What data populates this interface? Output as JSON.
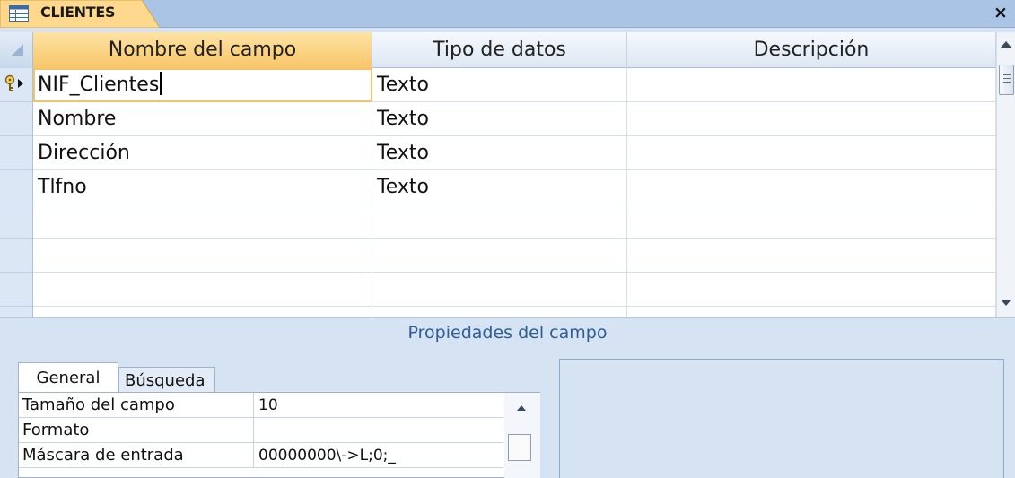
{
  "window": {
    "title": "CLIENTES",
    "table_icon": "table-icon",
    "close_icon": "close-icon",
    "close_glyph": "×"
  },
  "grid": {
    "columns": [
      "Nombre del campo",
      "Tipo de datos",
      "Descripción"
    ],
    "rows": [
      {
        "field": "NIF_Clientes",
        "type": "Texto",
        "description": "",
        "primary_key": true,
        "current": true
      },
      {
        "field": "Nombre",
        "type": "Texto",
        "description": ""
      },
      {
        "field": "Dirección",
        "type": "Texto",
        "description": ""
      },
      {
        "field": "Tlfno",
        "type": "Texto",
        "description": ""
      },
      {
        "field": "",
        "type": "",
        "description": ""
      },
      {
        "field": "",
        "type": "",
        "description": ""
      },
      {
        "field": "",
        "type": "",
        "description": ""
      }
    ]
  },
  "properties": {
    "header": "Propiedades del campo",
    "tabs": [
      "General",
      "Búsqueda"
    ],
    "active_tab": "General",
    "rows": [
      {
        "name": "Tamaño del campo",
        "value": "10"
      },
      {
        "name": "Formato",
        "value": ""
      },
      {
        "name": "Máscara de entrada",
        "value": "00000000\\->L;0;_"
      }
    ]
  },
  "colors": {
    "active_header": "#f8c66a",
    "titlebar": "#a9c4e4",
    "accent_text": "#2e5c95"
  }
}
